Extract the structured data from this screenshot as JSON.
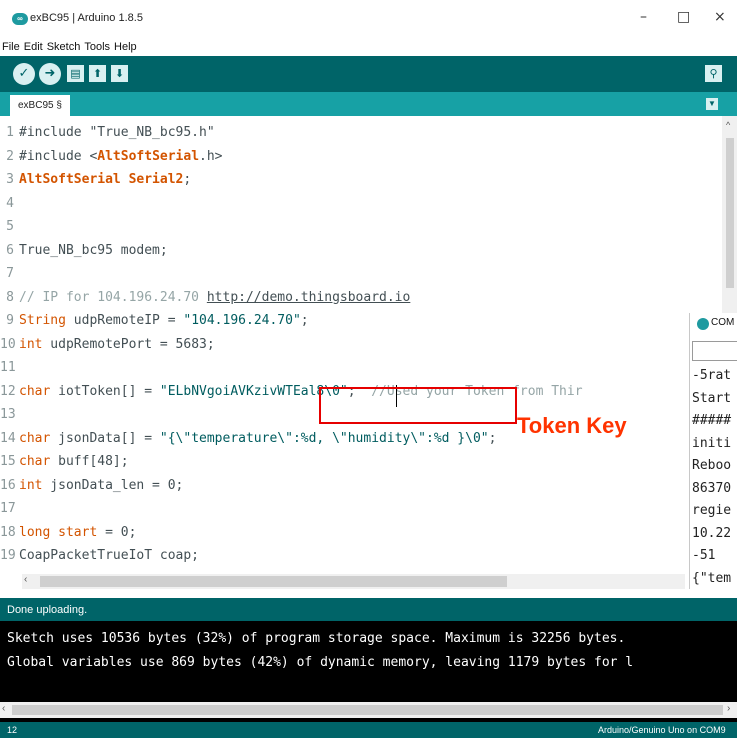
{
  "window": {
    "title": "exBC95 | Arduino 1.8.5",
    "app_icon_text": "∞"
  },
  "menu": [
    "File",
    "Edit",
    "Sketch",
    "Tools",
    "Help"
  ],
  "toolbar": {
    "verify_icon": "check-icon",
    "upload_icon": "arrow-right-icon",
    "new_icon": "new-file-icon",
    "open_icon": "arrow-up-icon",
    "save_icon": "arrow-down-icon",
    "serial_monitor_icon": "magnifier-icon"
  },
  "tab": {
    "label": "exBC95 §"
  },
  "code": [
    {
      "n": "1",
      "segs": [
        {
          "t": "#include \"True_NB_bc95.h\"",
          "c": ""
        }
      ]
    },
    {
      "n": "2",
      "segs": [
        {
          "t": "#include <",
          "c": ""
        },
        {
          "t": "AltSoftSerial",
          "c": "kwb"
        },
        {
          "t": ".h>",
          "c": ""
        }
      ]
    },
    {
      "n": "3",
      "segs": [
        {
          "t": "AltSoftSerial Serial2",
          "c": "kwb"
        },
        {
          "t": ";",
          "c": ""
        }
      ]
    },
    {
      "n": "4",
      "segs": []
    },
    {
      "n": "5",
      "segs": []
    },
    {
      "n": "6",
      "segs": [
        {
          "t": "True_NB_bc95 modem;",
          "c": ""
        }
      ]
    },
    {
      "n": "7",
      "segs": []
    },
    {
      "n": "8",
      "segs": [
        {
          "t": "// IP for 104.196.24.70 ",
          "c": "cmt"
        },
        {
          "t": "http://demo.thingsboard.io",
          "c": "lnk"
        }
      ]
    },
    {
      "n": "9",
      "segs": [
        {
          "t": "String",
          "c": "kw"
        },
        {
          "t": " udpRemoteIP = ",
          "c": ""
        },
        {
          "t": "\"104.196.24.70\"",
          "c": "str"
        },
        {
          "t": ";",
          "c": ""
        }
      ]
    },
    {
      "n": "10",
      "segs": [
        {
          "t": "int",
          "c": "kw"
        },
        {
          "t": " udpRemotePort = 5683;",
          "c": ""
        }
      ]
    },
    {
      "n": "11",
      "segs": []
    },
    {
      "n": "12",
      "segs": [
        {
          "t": "char",
          "c": "kw"
        },
        {
          "t": " iotToken[] = ",
          "c": ""
        },
        {
          "t": "\"ELbNVgoiAVKzivWTEal8\\0\"",
          "c": "str"
        },
        {
          "t": ";  ",
          "c": ""
        },
        {
          "t": "//Used your Token from Thir",
          "c": "cmt"
        }
      ]
    },
    {
      "n": "13",
      "segs": []
    },
    {
      "n": "14",
      "segs": [
        {
          "t": "char",
          "c": "kw"
        },
        {
          "t": " jsonData[] = ",
          "c": ""
        },
        {
          "t": "\"{\\\"temperature\\\":%d, \\\"humidity\\\":%d }\\0\"",
          "c": "str"
        },
        {
          "t": ";",
          "c": ""
        }
      ]
    },
    {
      "n": "15",
      "segs": [
        {
          "t": "char",
          "c": "kw"
        },
        {
          "t": " buff[48];",
          "c": ""
        }
      ]
    },
    {
      "n": "16",
      "segs": [
        {
          "t": "int",
          "c": "kw"
        },
        {
          "t": " jsonData_len = 0;",
          "c": ""
        }
      ]
    },
    {
      "n": "17",
      "segs": []
    },
    {
      "n": "18",
      "segs": [
        {
          "t": "long",
          "c": "kw"
        },
        {
          "t": " ",
          "c": ""
        },
        {
          "t": "start",
          "c": "kw"
        },
        {
          "t": " = 0;",
          "c": ""
        }
      ]
    },
    {
      "n": "19",
      "segs": [
        {
          "t": "CoapPacketTrueIoT coap;",
          "c": ""
        }
      ]
    }
  ],
  "serial_monitor": {
    "title": "COM",
    "lines": [
      "-5rat",
      "Start",
      "#####",
      "initi",
      "Reboo",
      "86370",
      "regie",
      "10.22",
      "-51",
      "{\"tem"
    ]
  },
  "annotation": {
    "label": "Token Key"
  },
  "status": {
    "message": "Done uploading."
  },
  "console": {
    "lines": [
      "Sketch uses 10536 bytes (32%) of program storage space. Maximum is 32256 bytes.",
      "Global variables use 869 bytes (42%) of dynamic memory, leaving 1179 bytes for l"
    ]
  },
  "bottom": {
    "line_number": "12",
    "board": "Arduino/Genuino Uno on COM9"
  }
}
